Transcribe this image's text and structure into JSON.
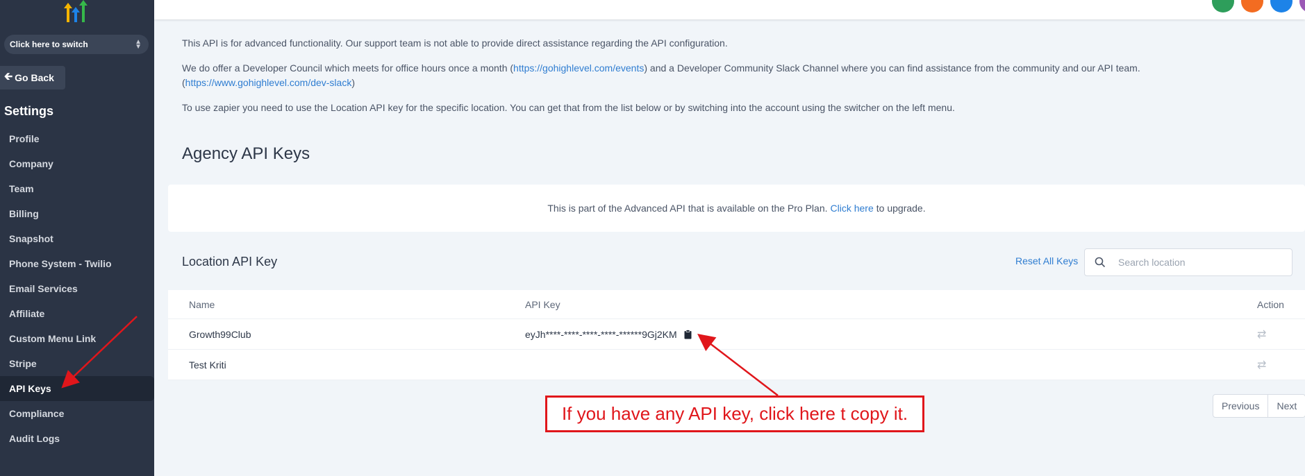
{
  "sidebar": {
    "switcher_label": "Click here to switch",
    "go_back_label": "Go Back",
    "settings_title": "Settings",
    "items": [
      {
        "label": "Profile",
        "active": false
      },
      {
        "label": "Company",
        "active": false
      },
      {
        "label": "Team",
        "active": false
      },
      {
        "label": "Billing",
        "active": false
      },
      {
        "label": "Snapshot",
        "active": false
      },
      {
        "label": "Phone System - Twilio",
        "active": false
      },
      {
        "label": "Email Services",
        "active": false
      },
      {
        "label": "Affiliate",
        "active": false
      },
      {
        "label": "Custom Menu Link",
        "active": false
      },
      {
        "label": "Stripe",
        "active": false
      },
      {
        "label": "API Keys",
        "active": true
      },
      {
        "label": "Compliance",
        "active": false
      },
      {
        "label": "Audit Logs",
        "active": false
      }
    ]
  },
  "main": {
    "info1": "This API is for advanced functionality. Our support team is not able to provide direct assistance regarding the API configuration.",
    "info2_a": "We do offer a Developer Council which meets for office hours once a month (",
    "info2_link1": "https://gohighlevel.com/events",
    "info2_b": ") and a Developer Community Slack Channel where you can find assistance from the community and our API team.",
    "info2_c": "(",
    "info2_link2": "https://www.gohighlevel.com/dev-slack",
    "info2_d": ")",
    "info3": "To use zapier you need to use the Location API key for the specific location. You can get that from the list below or by switching into the account using the switcher on the left menu.",
    "agency_title": "Agency API Keys",
    "pro_text_a": "This is part of the Advanced API that is available on the Pro Plan.",
    "pro_link": "Click here",
    "pro_text_b": "to upgrade.",
    "location_title": "Location API Key",
    "reset_all": "Reset All Keys",
    "search_placeholder": "Search location",
    "table": {
      "headers": {
        "name": "Name",
        "key": "API Key",
        "action": "Action"
      },
      "rows": [
        {
          "name": "Growth99Club",
          "key": "eyJh****-****-****-****-******9Gj2KM"
        },
        {
          "name": "Test Kriti",
          "key": ""
        }
      ]
    },
    "pager": {
      "prev": "Previous",
      "next": "Next"
    },
    "callout": "If you have any API key, click here t copy it."
  },
  "colors": {
    "sidebar_bg": "#2b3445",
    "link": "#2f7dd1",
    "annotation_red": "#e0161b",
    "top_icons": [
      "#2e9e5b",
      "#f36c21",
      "#1d83e8",
      "#9b59b6"
    ]
  }
}
